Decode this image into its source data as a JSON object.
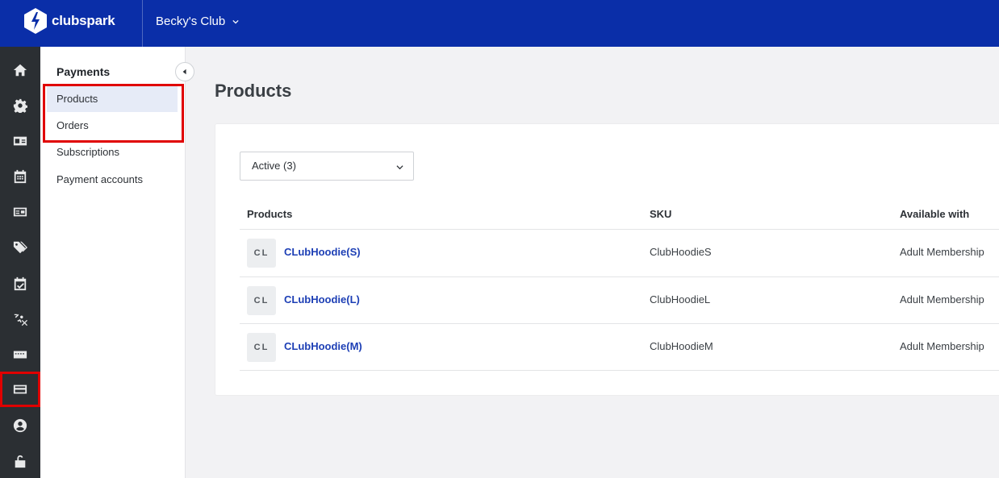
{
  "brand": {
    "name": "clubspark"
  },
  "header": {
    "club_name": "Becky's Club"
  },
  "rail": {
    "items": [
      {
        "icon": "home-icon"
      },
      {
        "icon": "gear-icon"
      },
      {
        "icon": "id-card-icon"
      },
      {
        "icon": "calendar-icon"
      },
      {
        "icon": "contact-card-icon"
      },
      {
        "icon": "tags-icon"
      },
      {
        "icon": "calendar-check-icon"
      },
      {
        "icon": "coaching-icon"
      },
      {
        "icon": "ticket-icon"
      },
      {
        "icon": "credit-card-icon",
        "active": true
      },
      {
        "icon": "user-circle-icon"
      },
      {
        "icon": "unlock-icon"
      }
    ]
  },
  "subnav": {
    "title": "Payments",
    "items": [
      {
        "label": "Products",
        "selected": true
      },
      {
        "label": "Orders"
      },
      {
        "label": "Subscriptions"
      },
      {
        "label": "Payment accounts"
      }
    ]
  },
  "main": {
    "title": "Products",
    "filter": {
      "selected": "Active (3)"
    },
    "table": {
      "headers": {
        "product": "Products",
        "sku": "SKU",
        "available": "Available with"
      },
      "rows": [
        {
          "thumb": "CL",
          "name": "CLubHoodie(S)",
          "sku": "ClubHoodieS",
          "available": "Adult Membership"
        },
        {
          "thumb": "CL",
          "name": "CLubHoodie(L)",
          "sku": "ClubHoodieL",
          "available": "Adult Membership"
        },
        {
          "thumb": "CL",
          "name": "CLubHoodie(M)",
          "sku": "ClubHoodieM",
          "available": "Adult Membership"
        }
      ]
    }
  },
  "colors": {
    "topbar": "#0a2ea8",
    "rail": "#2b2f33",
    "link": "#1d3fb5",
    "highlight": "#e00000"
  }
}
